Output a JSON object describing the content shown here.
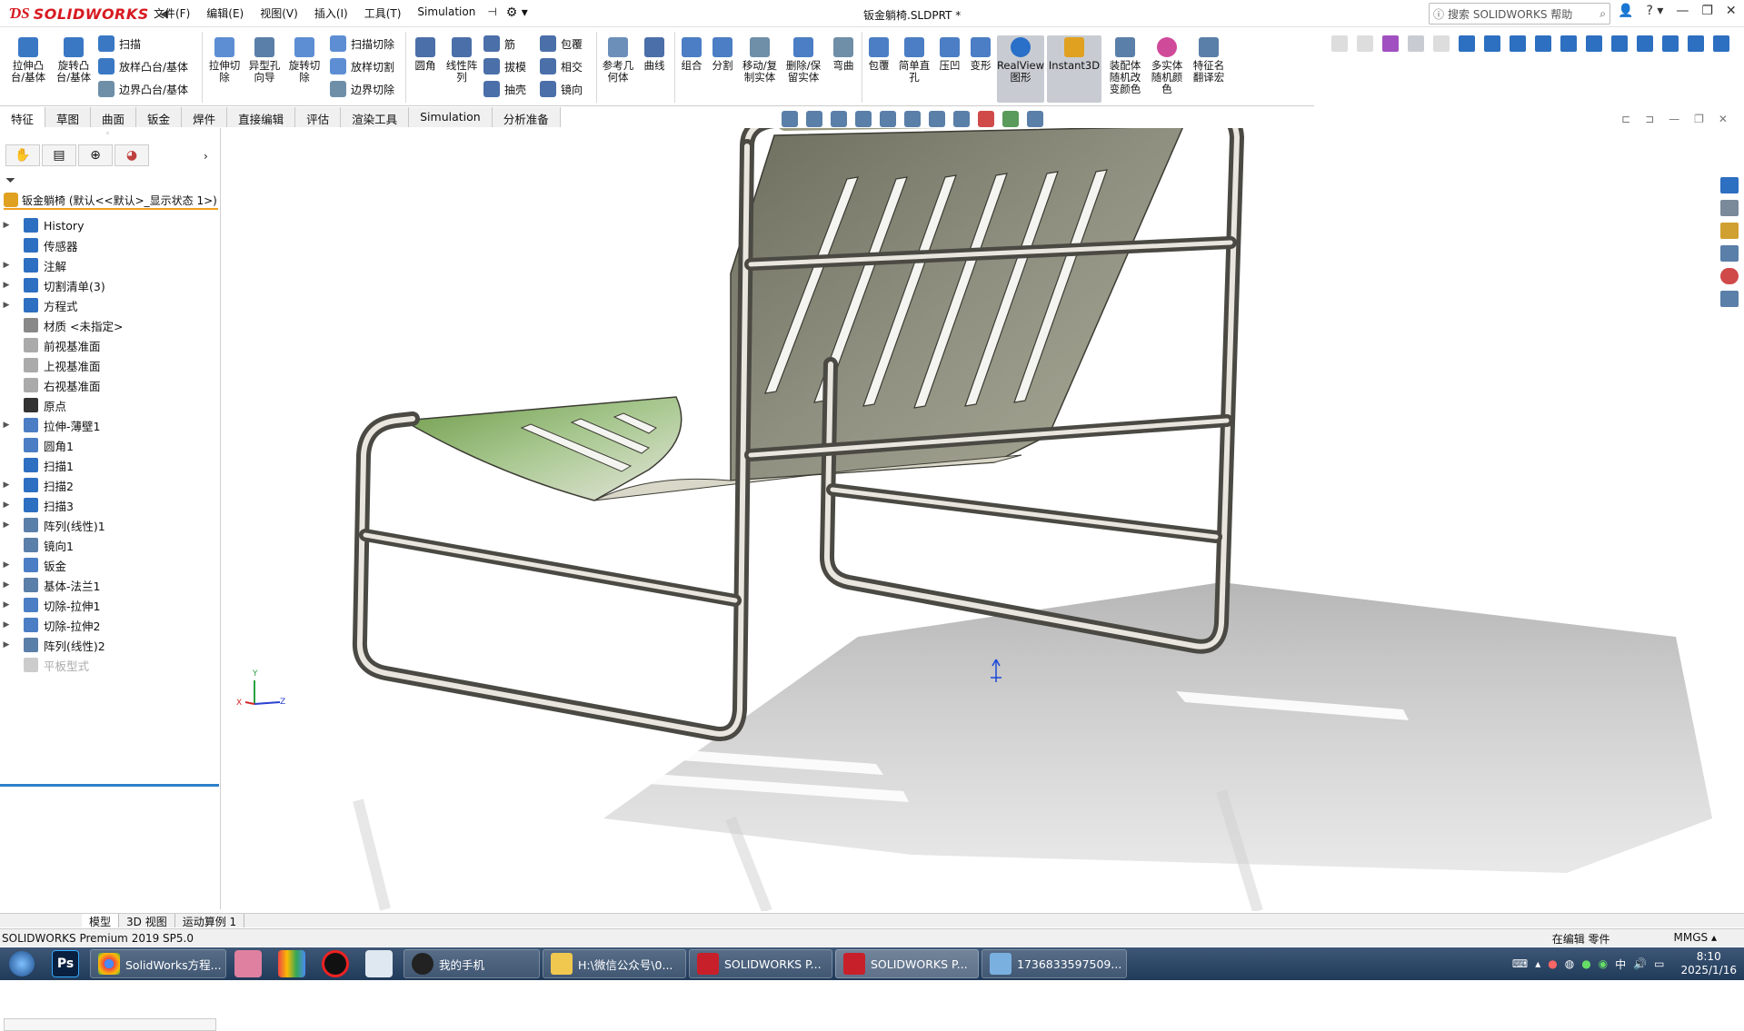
{
  "app": {
    "brand": "SOLIDWORKS",
    "doc_title": "钣金躺椅.SLDPRT *",
    "help_placeholder": "搜索 SOLIDWORKS 帮助"
  },
  "menu": [
    "文件(F)",
    "编辑(E)",
    "视图(V)",
    "插入(I)",
    "工具(T)",
    "Simulation"
  ],
  "ribbon": {
    "big": [
      {
        "label": "拉伸凸\n台/基体",
        "color": "#3a78c4"
      },
      {
        "label": "旋转凸\n台/基体",
        "color": "#3a78c4"
      },
      {
        "label": "拉伸切\n除",
        "color": "#5d8ed3"
      },
      {
        "label": "异型孔\n向导",
        "color": "#5a7fa8"
      },
      {
        "label": "旋转切\n除",
        "color": "#5d8ed3"
      },
      {
        "label": "圆角",
        "color": "#4b6fa8"
      },
      {
        "label": "线性阵\n列",
        "color": "#4b6fa8"
      },
      {
        "label": "参考几\n何体",
        "color": "#6b8fb8"
      },
      {
        "label": "曲线",
        "color": "#4b6fa8"
      },
      {
        "label": "组合",
        "color": "#4b7ec4"
      },
      {
        "label": "分割",
        "color": "#4b7ec4"
      },
      {
        "label": "移动/复\n制实体",
        "color": "#6f8fa8"
      },
      {
        "label": "删除/保\n留实体",
        "color": "#4b7ec4"
      },
      {
        "label": "弯曲",
        "color": "#6f8fa8"
      },
      {
        "label": "包覆",
        "color": "#4b7ec4"
      },
      {
        "label": "简单直\n孔",
        "color": "#4b7ec4"
      },
      {
        "label": "压凹",
        "color": "#4b7ec4"
      },
      {
        "label": "变形",
        "color": "#4b7ec4"
      },
      {
        "label": "RealView\n图形",
        "color": "#2a6fc8"
      },
      {
        "label": "Instant3D",
        "color": "#e0a020"
      },
      {
        "label": "装配体\n随机改\n变颜色",
        "color": "#5a7fa8"
      },
      {
        "label": "多实体\n随机颜\n色",
        "color": "#d04a9a"
      },
      {
        "label": "特征名\n翻译宏",
        "color": "#5a7fa8"
      }
    ],
    "small": [
      {
        "label": "扫描"
      },
      {
        "label": "放样凸台/基体"
      },
      {
        "label": "边界凸台/基体"
      },
      {
        "label": "扫描切除"
      },
      {
        "label": "放样切割"
      },
      {
        "label": "边界切除"
      },
      {
        "label": "筋"
      },
      {
        "label": "拔模"
      },
      {
        "label": "抽壳"
      },
      {
        "label": "包覆"
      },
      {
        "label": "相交"
      },
      {
        "label": "镜向"
      }
    ]
  },
  "tabs": [
    "特征",
    "草图",
    "曲面",
    "钣金",
    "焊件",
    "直接编辑",
    "评估",
    "渲染工具",
    "Simulation",
    "分析准备"
  ],
  "tree": {
    "root": "钣金躺椅 (默认<<默认>_显示状态 1>)",
    "nodes": [
      {
        "label": "History",
        "expand": true
      },
      {
        "label": "传感器",
        "expand": false
      },
      {
        "label": "注解",
        "expand": true
      },
      {
        "label": "切割清单(3)",
        "expand": true
      },
      {
        "label": "方程式",
        "expand": true
      },
      {
        "label": "材质 <未指定>",
        "expand": false
      },
      {
        "label": "前视基准面",
        "expand": false
      },
      {
        "label": "上视基准面",
        "expand": false
      },
      {
        "label": "右视基准面",
        "expand": false
      },
      {
        "label": "原点",
        "expand": false
      },
      {
        "label": "拉伸-薄壁1",
        "expand": true
      },
      {
        "label": "圆角1",
        "expand": false
      },
      {
        "label": "扫描1",
        "expand": false
      },
      {
        "label": "扫描2",
        "expand": true
      },
      {
        "label": "扫描3",
        "expand": true
      },
      {
        "label": "阵列(线性)1",
        "expand": true
      },
      {
        "label": "镜向1",
        "expand": false
      },
      {
        "label": "钣金",
        "expand": true
      },
      {
        "label": "基体-法兰1",
        "expand": true
      },
      {
        "label": "切除-拉伸1",
        "expand": true
      },
      {
        "label": "切除-拉伸2",
        "expand": true
      },
      {
        "label": "阵列(线性)2",
        "expand": true
      },
      {
        "label": "平板型式",
        "expand": false,
        "dim": true
      }
    ]
  },
  "bottom_tabs": [
    "模型",
    "3D 视图",
    "运动算例 1"
  ],
  "status": {
    "left": "SOLIDWORKS Premium 2019 SP5.0",
    "edit": "在编辑 零件",
    "units": "MMGS"
  },
  "taskbar": {
    "tasks": [
      "SolidWorks方程...",
      "我的手机",
      "H:\\微信公众号\\0...",
      "SOLIDWORKS P...",
      "SOLIDWORKS P...",
      "1736833597509..."
    ],
    "time": "8:10",
    "date": "2025/1/16"
  },
  "triad": {
    "x": "X",
    "y": "Y",
    "z": "Z"
  }
}
